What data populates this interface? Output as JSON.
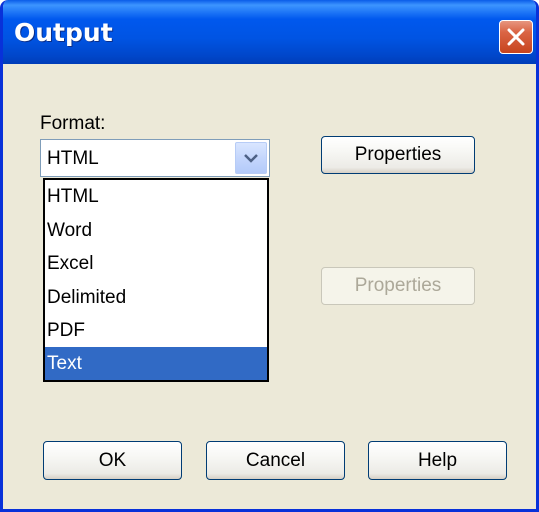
{
  "window": {
    "title": "Output"
  },
  "format": {
    "label": "Format:",
    "selected_value": "HTML",
    "options": [
      {
        "label": "HTML",
        "selected": false
      },
      {
        "label": "Word",
        "selected": false
      },
      {
        "label": "Excel",
        "selected": false
      },
      {
        "label": "Delimited",
        "selected": false
      },
      {
        "label": "PDF",
        "selected": false
      },
      {
        "label": "Text",
        "selected": true
      }
    ]
  },
  "buttons": {
    "properties_1": "Properties",
    "properties_2": "Properties",
    "ok": "OK",
    "cancel": "Cancel",
    "help": "Help"
  },
  "colors": {
    "titlebar": "#0054E3",
    "dialog_bg": "#ECE9D8",
    "selection": "#316AC5",
    "close_button": "#C7441E",
    "disabled_text": "#ACA899"
  }
}
